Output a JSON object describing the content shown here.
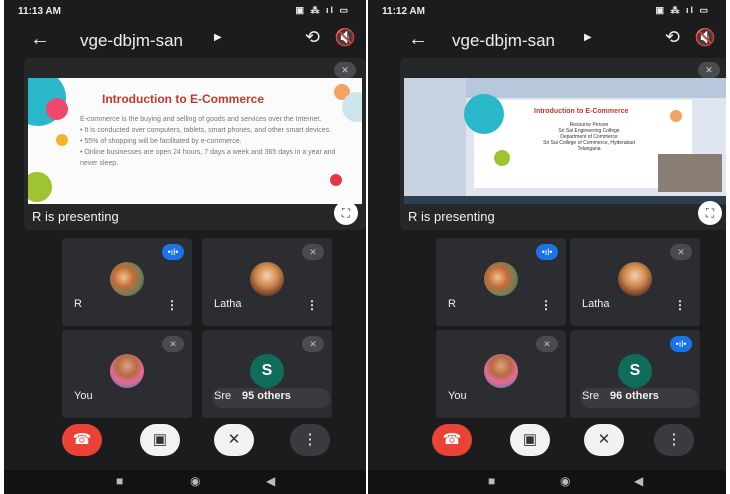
{
  "screens": [
    {
      "time": "11:13 AM",
      "sys_icons": "▣ ⁂ ıl ▭",
      "meeting_code": "vge-dbjm-san",
      "slide": {
        "title": "Introduction to E-Commerce",
        "body": "E-commerce is the buying and selling of goods and services over the Internet.\n• It is conducted over computers, tablets, smart phones, and other smart devices.\n• 55% of shopping will be facilitated by e-commerce.\n• Online businesses are open 24 hours, 7 days a week and 365 days in a year and never sleep."
      },
      "presenting_label": "R is presenting",
      "tiles": [
        {
          "name": "R",
          "avatar": "R",
          "mic": "active"
        },
        {
          "name": "Latha",
          "avatar": "Latha",
          "mic": "muted"
        },
        {
          "name": "You",
          "avatar": "You",
          "mic": "muted"
        },
        {
          "name": "Sre",
          "avatar": "S",
          "mic": "muted",
          "others": "95 others"
        }
      ]
    },
    {
      "time": "11:12 AM",
      "sys_icons": "▣ ⁂ ıl ▭",
      "meeting_code": "vge-dbjm-san",
      "slide": {
        "title": "Introduction to E-Commerce",
        "body": "Resource Person\nSri Sai Engineering College\nDepartment of Commerce\nSri Sai College of Commerce, Hyderabad\nTelangana"
      },
      "presenting_label": "R is presenting",
      "tiles": [
        {
          "name": "R",
          "avatar": "R",
          "mic": "active"
        },
        {
          "name": "Latha",
          "avatar": "Latha",
          "mic": "muted"
        },
        {
          "name": "You",
          "avatar": "You",
          "mic": "muted"
        },
        {
          "name": "Sre",
          "avatar": "S",
          "mic": "active",
          "others": "96 others"
        }
      ]
    }
  ],
  "colors": {
    "end_call": "#ea4335",
    "active_mic": "#1a73e8",
    "avatar_s": "#0f6b5a",
    "slide_title": "#c0392b"
  },
  "icons": {
    "back": "arrow-left-icon",
    "caret": "caret-right-icon",
    "camera_switch": "camera-switch-icon",
    "speaker": "speaker-off-icon",
    "fullscreen": "fullscreen-icon",
    "end_call": "phone-hangup-icon",
    "camera": "camera-off-icon",
    "mic": "mic-off-icon",
    "more": "more-vert-icon"
  }
}
